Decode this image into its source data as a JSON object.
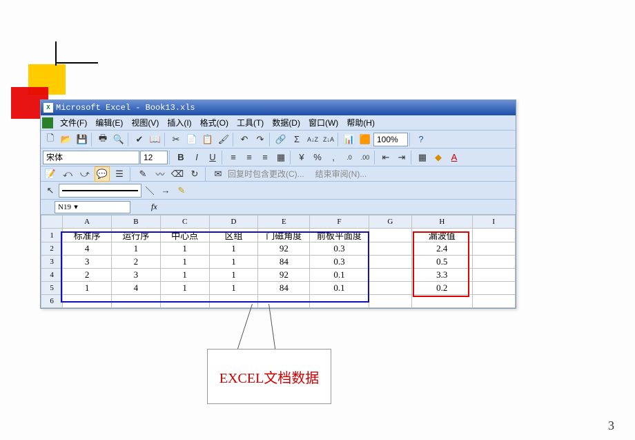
{
  "page_number": "3",
  "callout_label": "EXCEL文档数据",
  "titlebar": {
    "title": "Microsoft Excel - Book13.xls"
  },
  "menus": {
    "file": "文件(F)",
    "edit": "编辑(E)",
    "view": "视图(V)",
    "insert": "插入(I)",
    "format": "格式(O)",
    "tools": "工具(T)",
    "data": "数据(D)",
    "window": "窗口(W)",
    "help": "帮助(H)"
  },
  "font": {
    "name": "宋体",
    "size": "12"
  },
  "zoom": "100%",
  "review_text1": "回复时包含更改(C)...",
  "review_text2": "结束审阅(N)...",
  "namebox": "N19",
  "fx": "fx",
  "chart_data": {
    "type": "table",
    "columns": [
      "A",
      "B",
      "C",
      "D",
      "E",
      "F",
      "G",
      "H",
      "I"
    ],
    "headers_row": [
      "标准序",
      "运行序",
      "中心点",
      "区组",
      "门磁角度",
      "前板平面度",
      "",
      "漏波值",
      ""
    ],
    "rows": [
      [
        "4",
        "1",
        "1",
        "1",
        "92",
        "0.3",
        "",
        "2.4",
        ""
      ],
      [
        "3",
        "2",
        "1",
        "1",
        "84",
        "0.3",
        "",
        "0.5",
        ""
      ],
      [
        "2",
        "3",
        "1",
        "1",
        "92",
        "0.1",
        "",
        "3.3",
        ""
      ],
      [
        "1",
        "4",
        "1",
        "1",
        "84",
        "0.1",
        "",
        "0.2",
        ""
      ],
      [
        "",
        "",
        "",
        "",
        "",
        "",
        "",
        "",
        ""
      ]
    ],
    "row_numbers": [
      "1",
      "2",
      "3",
      "4",
      "5",
      "6"
    ]
  },
  "colors": {
    "blue_box": "#1010C0",
    "red_box": "#E00000",
    "accent_yellow": "#FFCC00",
    "accent_red": "#E60000"
  }
}
